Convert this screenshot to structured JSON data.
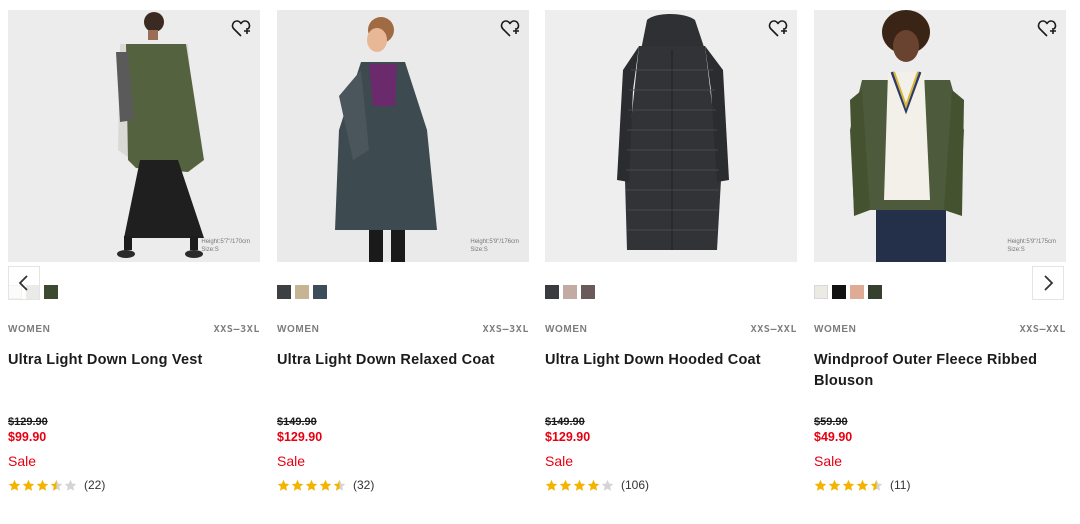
{
  "products": [
    {
      "gender": "WOMEN",
      "sizes": "XXS–3XL",
      "title": "Ultra Light Down Long Vest",
      "price_original": "$129.90",
      "price_sale": "$99.90",
      "sale_label": "Sale",
      "rating": 3.5,
      "review_count": "(22)",
      "model_info": [
        "Height:5'7\"/170cm",
        "Size:S"
      ],
      "swatches": [
        "#f2f2ee",
        "#b9b9b4",
        "#3c4a32"
      ]
    },
    {
      "gender": "WOMEN",
      "sizes": "XXS–3XL",
      "title": "Ultra Light Down Relaxed Coat",
      "price_original": "$149.90",
      "price_sale": "$129.90",
      "sale_label": "Sale",
      "rating": 4.5,
      "review_count": "(32)",
      "model_info": [
        "Height:5'9\"/176cm",
        "Size:S"
      ],
      "swatches": [
        "#3d4043",
        "#c7b493",
        "#3c4c58"
      ]
    },
    {
      "gender": "WOMEN",
      "sizes": "XXS–XXL",
      "title": "Ultra Light Down Hooded Coat",
      "price_original": "$149.90",
      "price_sale": "$129.90",
      "sale_label": "Sale",
      "rating": 4,
      "review_count": "(106)",
      "model_info": [],
      "swatches": [
        "#3a3b3e",
        "#c2aba2",
        "#6b5a5a"
      ]
    },
    {
      "gender": "WOMEN",
      "sizes": "XXS–XXL",
      "title": "Windproof Outer Fleece Ribbed Blouson",
      "price_original": "$59.90",
      "price_sale": "$49.90",
      "sale_label": "Sale",
      "rating": 4.5,
      "review_count": "(11)",
      "model_info": [
        "Height:5'9\"/175cm",
        "Size:S"
      ],
      "swatches": [
        "#ecebe3",
        "#111111",
        "#dfab94",
        "#36402e"
      ]
    }
  ],
  "colors": {
    "sale_red": "#e60012",
    "star_gold": "#f3b400",
    "star_empty": "#d4d4d4",
    "image_bg": "#eeeeee"
  },
  "icons": {
    "favorite": "heart-plus-icon",
    "prev": "chevron-left-icon",
    "next": "chevron-right-icon",
    "rating": "star-icon"
  }
}
